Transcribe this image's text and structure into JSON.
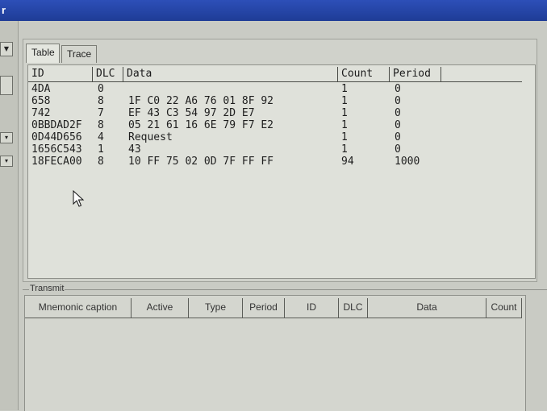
{
  "window": {
    "title_fragment": "r"
  },
  "tabs": [
    {
      "label": "Table",
      "active": true
    },
    {
      "label": "Trace",
      "active": false
    }
  ],
  "table": {
    "columns": [
      "ID",
      "DLC",
      "Data",
      "Count",
      "Period"
    ],
    "rows": [
      {
        "id": "4DA",
        "dlc": "0",
        "data": "",
        "count": "1",
        "period": "0"
      },
      {
        "id": "658",
        "dlc": "8",
        "data": "1F C0 22 A6 76 01 8F 92",
        "count": "1",
        "period": "0"
      },
      {
        "id": "742",
        "dlc": "7",
        "data": "EF 43 C3 54 97 2D E7",
        "count": "1",
        "period": "0"
      },
      {
        "id": "0BBDAD2F",
        "dlc": "8",
        "data": "05 21 61 16 6E 79 F7 E2",
        "count": "1",
        "period": "0"
      },
      {
        "id": "0D44D656",
        "dlc": "4",
        "data": "Request",
        "count": "1",
        "period": "0"
      },
      {
        "id": "1656C543",
        "dlc": "1",
        "data": "43",
        "count": "1",
        "period": "0"
      },
      {
        "id": "18FECA00",
        "dlc": "8",
        "data": "10 FF 75 02 0D 7F FF FF",
        "count": "94",
        "period": "1000"
      }
    ]
  },
  "transmit": {
    "label": "Transmit",
    "columns": [
      "Mnemonic caption",
      "Active",
      "Type",
      "Period",
      "ID",
      "DLC",
      "Data",
      "Count"
    ]
  },
  "colors": {
    "titlebar": "#1e3c96",
    "background": "#c9cbc4",
    "grid": "#dfe1da"
  }
}
